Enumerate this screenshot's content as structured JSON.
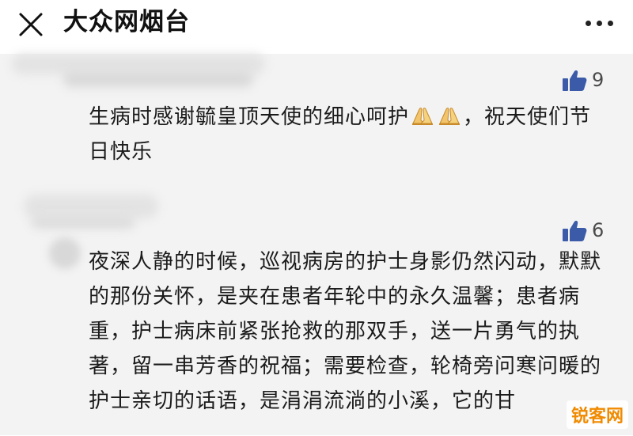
{
  "header": {
    "title": "大众网烟台",
    "close_icon": "close-icon",
    "more_icon": "more-dots-icon"
  },
  "comments": [
    {
      "likes": "9",
      "text_before_emoji": "生病时感谢毓皇顶天使的细心呵护",
      "emoji": [
        "folded-hands-icon",
        "folded-hands-icon"
      ],
      "text_after_emoji": "，祝天使们节日快乐"
    },
    {
      "likes": "6",
      "text": "夜深人静的时候，巡视病房的护士身影仍然闪动，默默的那份关怀，是夹在患者年轮中的永久温馨；患者病重，护士病床前紧张抢救的那双手，送一片勇气的执著，留一串芳香的祝福；需要检查，轮椅旁问寒问暖的护士亲切的话语，是涓涓流淌的小溪，它的甘"
    }
  ],
  "watermark": "锐客网",
  "colors": {
    "like_icon": "#3b5ba9",
    "background": "#f3f3f3",
    "watermark": "#f08a00"
  }
}
